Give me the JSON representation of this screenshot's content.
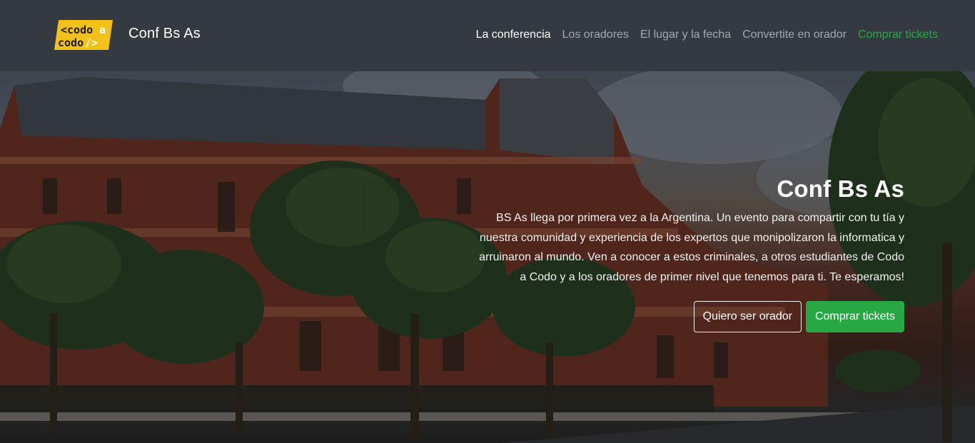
{
  "navbar": {
    "logo": {
      "line1": "<codo",
      "line1_accent": "a",
      "line2": "codo/>",
      "bg_color": "#f2c21b",
      "text_color": "#1a1a1a"
    },
    "brand": "Conf Bs As",
    "links": [
      {
        "label": "La conferencia"
      },
      {
        "label": "Los oradores"
      },
      {
        "label": "El lugar y la fecha"
      },
      {
        "label": "Convertite en orador"
      },
      {
        "label": "Comprar tickets"
      }
    ]
  },
  "hero": {
    "title": "Conf Bs As",
    "text": "BS As llega por primera vez a la Argentina. Un evento para compartir con tu tía y nuestra comunidad y experiencia de los expertos que monipolizaron la informatica y arruinaron al mundo. Ven a conocer a estos criminales, a otros estudiantes de Codo a Codo y a los oradores de primer nivel que tenemos para ti. Te esperamos!",
    "buttons": {
      "speaker": "Quiero ser orador",
      "tickets": "Comprar tickets"
    }
  },
  "colors": {
    "navbar_bg": "#343a40",
    "accent_green": "#28a745",
    "logo_yellow": "#f2c21b"
  }
}
